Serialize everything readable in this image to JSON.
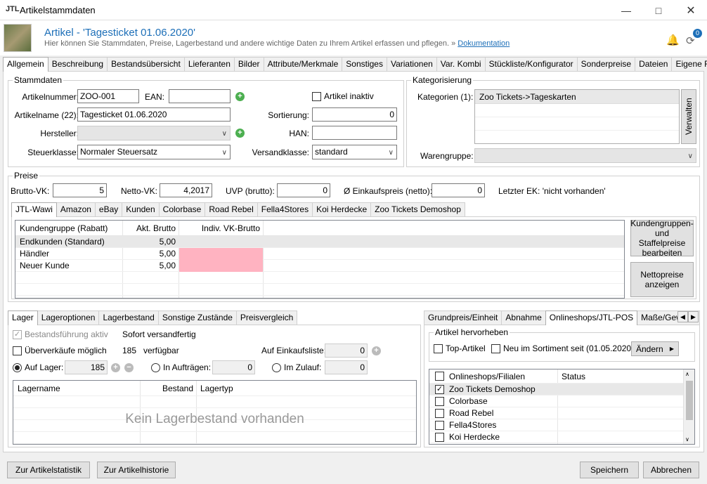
{
  "window": {
    "title": "Artikelstammdaten",
    "logo": "JTL"
  },
  "header": {
    "title": "Artikel - 'Tagesticket 01.06.2020'",
    "subtitle": "Hier können Sie Stammdaten, Preise, Lagerbestand und andere wichtige Daten zu Ihrem Artikel erfassen und pflegen.",
    "arrow": "»",
    "doc_link": "Dokumentation",
    "badge": "0"
  },
  "main_tabs": [
    "Allgemein",
    "Beschreibung",
    "Bestandsübersicht",
    "Lieferanten",
    "Bilder",
    "Attribute/Merkmale",
    "Sonstiges",
    "Variationen",
    "Var. Kombi",
    "Stückliste/Konfigurator",
    "Sonderpreise",
    "Dateien",
    "Eigene Felder"
  ],
  "stammdaten": {
    "legend": "Stammdaten",
    "artnr_label": "Artikelnummer:",
    "artnr": "ZOO-001",
    "ean_label": "EAN:",
    "ean": "",
    "inaktiv_label": "Artikel inaktiv",
    "name_label": "Artikelname (22):",
    "name": "Tagesticket 01.06.2020",
    "sort_label": "Sortierung:",
    "sort": "0",
    "hersteller_label": "Hersteller:",
    "hersteller": "",
    "han_label": "HAN:",
    "han": "",
    "steuer_label": "Steuerklasse:",
    "steuer": "Normaler Steuersatz",
    "versand_label": "Versandklasse:",
    "versand": "standard"
  },
  "kategorisierung": {
    "legend": "Kategorisierung",
    "kat_label": "Kategorien (1):",
    "kat_item": "Zoo Tickets->Tageskarten",
    "verwalten": "Verwalten",
    "warengruppe_label": "Warengruppe:",
    "warengruppe": ""
  },
  "preise": {
    "legend": "Preise",
    "brutto_label": "Brutto-VK:",
    "brutto": "5",
    "netto_label": "Netto-VK:",
    "netto": "4,2017",
    "uvp_label": "UVP (brutto):",
    "uvp": "0",
    "ek_label": "Ø Einkaufspreis (netto):",
    "ek": "0",
    "letzter_ek": "Letzter EK: 'nicht vorhanden'",
    "tabs": [
      "JTL-Wawi",
      "Amazon",
      "eBay",
      "Kunden",
      "Colorbase",
      "Road Rebel",
      "Fella4Stores",
      "Koi Herdecke",
      "Zoo Tickets Demoshop"
    ],
    "cols": [
      "Kundengruppe (Rabatt)",
      "Akt. Brutto",
      "Indiv. VK-Brutto"
    ],
    "rows": [
      {
        "gruppe": "Endkunden (Standard)",
        "brutto": "5,00",
        "indiv": ""
      },
      {
        "gruppe": "Händler",
        "brutto": "5,00",
        "indiv": ""
      },
      {
        "gruppe": "Neuer Kunde",
        "brutto": "5,00",
        "indiv": ""
      }
    ],
    "btn_staffel": "Kundengruppen- und Staffelpreise bearbeiten",
    "btn_netto": "Nettopreise anzeigen"
  },
  "lager": {
    "tabs": [
      "Lager",
      "Lageroptionen",
      "Lagerbestand",
      "Sonstige Zustände",
      "Preisvergleich"
    ],
    "bestand_aktiv": "Bestandsführung aktiv",
    "sofort": "Sofort versandfertig",
    "ueberverkauf": "Überverkäufe möglich",
    "verfuegbar_val": "185",
    "verfuegbar": "verfügbar",
    "einkaufsliste_label": "Auf Einkaufsliste:",
    "einkaufsliste": "0",
    "auf_lager_label": "Auf Lager:",
    "auf_lager": "185",
    "in_auftraegen_label": "In Aufträgen:",
    "in_auftraegen": "0",
    "im_zulauf_label": "Im Zulauf:",
    "im_zulauf": "0",
    "cols": [
      "Lagername",
      "Bestand",
      "Lagertyp"
    ],
    "empty": "Kein Lagerbestand vorhanden"
  },
  "right": {
    "tabs": [
      "Grundpreis/Einheit",
      "Abnahme",
      "Onlineshops/JTL-POS",
      "Maße/Gewicht"
    ],
    "hervorheben_legend": "Artikel hervorheben",
    "top_artikel": "Top-Artikel",
    "neu_sortiment": "Neu im Sortiment seit (01.05.2020)",
    "aendern": "Ändern",
    "cols": [
      "Onlineshops/Filialen",
      "Status"
    ],
    "shops": [
      {
        "name": "Zoo Tickets Demoshop",
        "checked": true
      },
      {
        "name": "Colorbase",
        "checked": false
      },
      {
        "name": "Road Rebel",
        "checked": false
      },
      {
        "name": "Fella4Stores",
        "checked": false
      },
      {
        "name": "Koi Herdecke",
        "checked": false
      }
    ]
  },
  "footer": {
    "statistik": "Zur Artikelstatistik",
    "historie": "Zur Artikelhistorie",
    "speichern": "Speichern",
    "abbrechen": "Abbrechen"
  }
}
